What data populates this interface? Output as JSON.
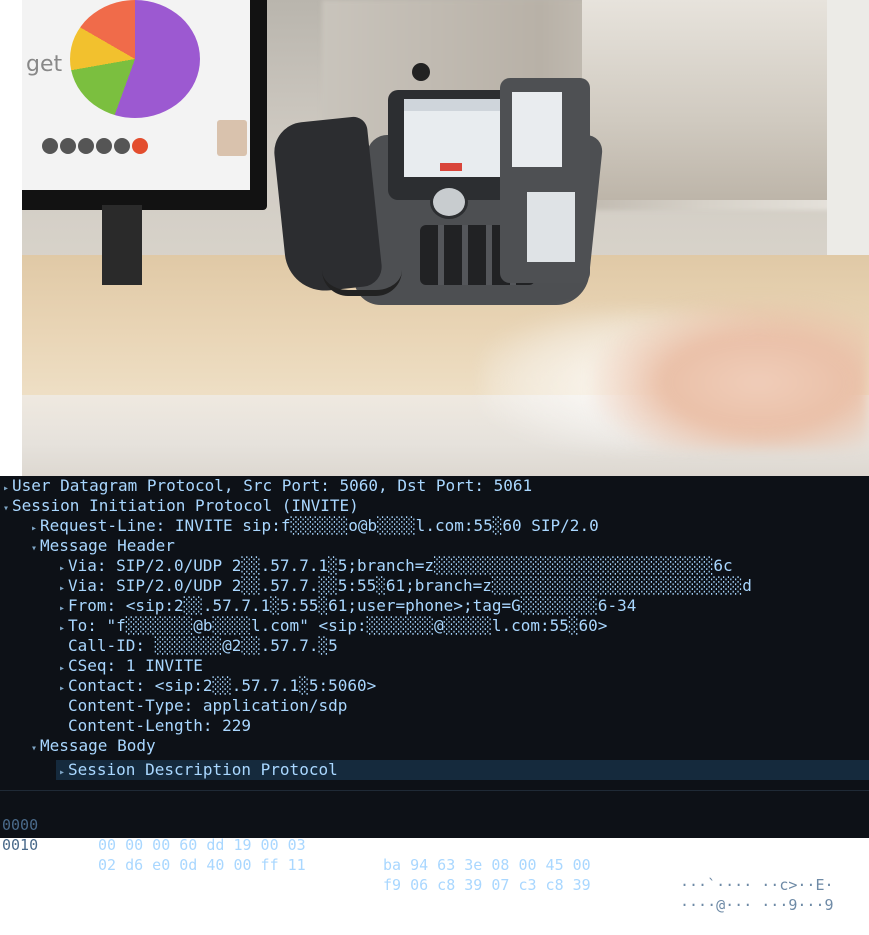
{
  "colors": {
    "pane_background": "#0d1117",
    "text": "#a9d7ff",
    "selected_row": "#152a3d",
    "offset_text": "#4a6a8a"
  },
  "photo": {
    "monitor_text": "get"
  },
  "packet_details": {
    "rows": [
      {
        "arrow": "▸",
        "text": "User Datagram Protocol, Src Port: 5060, Dst Port: 5061"
      },
      {
        "arrow": "▾",
        "text": "Session Initiation Protocol (INVITE)"
      },
      {
        "arrow": "▸",
        "text": "Request-Line: INVITE sip:f░░░░░░o@b░░░░l.com:55░60 SIP/2.0"
      },
      {
        "arrow": "▾",
        "text": "Message Header"
      },
      {
        "arrow": "▸",
        "text": "Via: SIP/2.0/UDP 2░░.57.7.1░5;branch=z░░░░░░░░░░░░░░░░░░░░░░░░░░░░░6c"
      },
      {
        "arrow": "▸",
        "text": "Via: SIP/2.0/UDP 2░░.57.7.░░5:55░61;branch=z░░░░░░░░░░░░░░░░░░░░░░░░░░d"
      },
      {
        "arrow": "▸",
        "text": "From: <sip:2░░.57.7.1░5:55░61;user=phone>;tag=G░░░░░░░░6-34"
      },
      {
        "arrow": "▸",
        "text": "To: \"f░░░░░░░@b░░░░l.com\" <sip:░░░░░░░@░░░░░l.com:55░60>"
      },
      {
        "arrow": "",
        "text": "Call-ID: ░░░░░░░@2░░.57.7.░5"
      },
      {
        "arrow": "▸",
        "text": "CSeq: 1 INVITE"
      },
      {
        "arrow": "▸",
        "text": "Contact: <sip:2░░.57.7.1░5:5060>"
      },
      {
        "arrow": "",
        "text": "Content-Type: application/sdp"
      },
      {
        "arrow": "",
        "text": "Content-Length:   229"
      },
      {
        "arrow": "▾",
        "text": "Message Body"
      },
      {
        "arrow": "▸",
        "text": "Session Description Protocol"
      }
    ]
  },
  "packet_bytes": {
    "rows": [
      {
        "offset": "0000",
        "hex1": "00 00 00 60 dd 19 00 03",
        "hex2": "ba 94 63 3e 08 00 45 00",
        "ascii": "···`···· ··c>··E·"
      },
      {
        "offset": "0010",
        "hex1": "02 d6 e0 0d 40 00 ff 11",
        "hex2": "f9 06 c8 39 07 c3 c8 39",
        "ascii": "····@··· ···9···9"
      }
    ]
  }
}
